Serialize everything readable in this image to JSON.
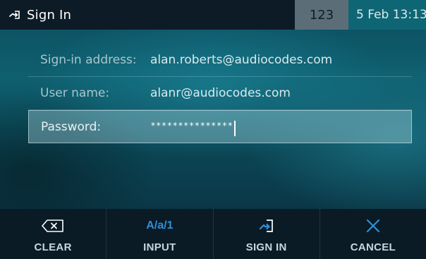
{
  "colors": {
    "accent": "#2f8fd8",
    "topbar_bg": "#0d1b26",
    "badge_bg": "#5b6e77",
    "time_bg": "#0e6675",
    "softbar_bg": "#0a1b26"
  },
  "header": {
    "title_icon": "sign-in-arrow-icon",
    "title": "Sign In",
    "input_mode_badge": "123",
    "datetime": "5 Feb 13:13"
  },
  "form": {
    "fields": [
      {
        "label": "Sign-in address:",
        "value": "alan.roberts@audiocodes.com"
      },
      {
        "label": "User name:",
        "value": "alanr@audiocodes.com"
      },
      {
        "label": "Password:",
        "value": "***************",
        "focused": true
      }
    ]
  },
  "softkeys": [
    {
      "label": "CLEAR",
      "icon": "backspace-icon"
    },
    {
      "label": "INPUT",
      "icon": "input-mode-icon",
      "icon_text": "A/a/1"
    },
    {
      "label": "SIGN IN",
      "icon": "sign-in-arrow-icon"
    },
    {
      "label": "CANCEL",
      "icon": "close-icon"
    }
  ]
}
